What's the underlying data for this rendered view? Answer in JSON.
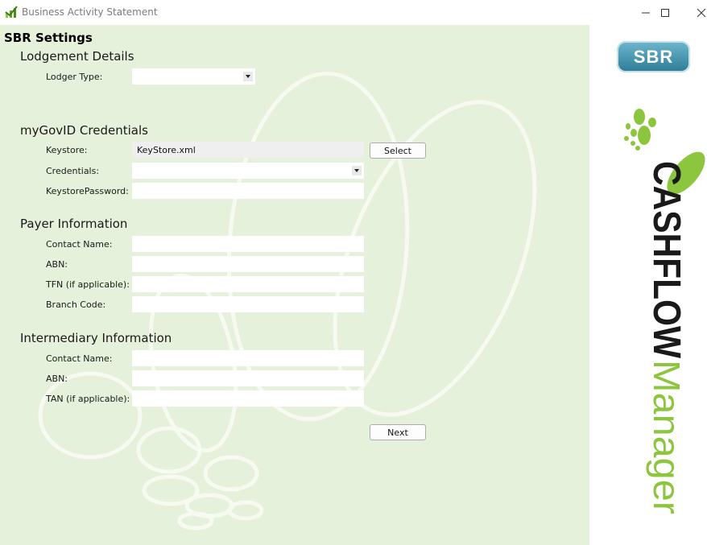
{
  "window": {
    "title": "Business Activity Statement"
  },
  "page": {
    "heading": "SBR Settings"
  },
  "lodgement": {
    "heading": "Lodgement Details",
    "lodger_type_label": "Lodger Type:",
    "lodger_type_value": ""
  },
  "credentials": {
    "heading": "myGovID Credentials",
    "keystore_label": "Keystore:",
    "keystore_value": "KeyStore.xml",
    "select_button": "Select",
    "credentials_label": "Credentials:",
    "credentials_value": "",
    "password_label": "KeystorePassword:",
    "password_value": ""
  },
  "payer": {
    "heading": "Payer Information",
    "contact_label": "Contact Name:",
    "abn_label": "ABN:",
    "tfn_label": "TFN (if applicable):",
    "branch_label": "Branch Code:",
    "contact_value": "",
    "abn_value": "",
    "tfn_value": "",
    "branch_value": ""
  },
  "intermediary": {
    "heading": "Intermediary Information",
    "contact_label": "Contact Name:",
    "abn_label": "ABN:",
    "tan_label": "TAN (if applicable):",
    "contact_value": "",
    "abn_value": "",
    "tan_value": ""
  },
  "actions": {
    "next_button": "Next"
  },
  "branding": {
    "sbr_logo_text": "SBR",
    "product_word_1": "CASHFLOW",
    "product_word_2": "Manager",
    "colors": {
      "green": "#8cc63f",
      "dark": "#1a1a1a",
      "sbr_blue": "#2b7b96",
      "form_background": "#e5f1da"
    }
  }
}
